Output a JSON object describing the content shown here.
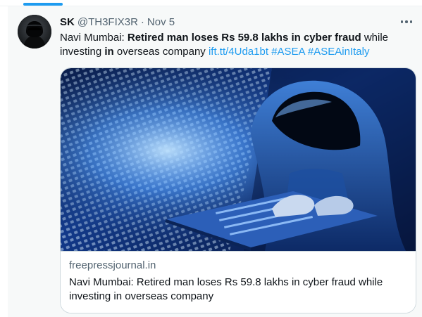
{
  "tweet": {
    "display_name": "SK",
    "handle": "@TH3FIX3R",
    "separator": "·",
    "timestamp": "Nov 5",
    "text": {
      "part1": "Navi Mumbai: ",
      "bold1": "Retired man loses Rs 59.8 lakhs in cyber fraud",
      "part2": " while investing ",
      "bold2": "in",
      "part3": " overseas company ",
      "link": "ift.tt/4Uda1bt",
      "space": " ",
      "hashtag1": "#ASEA",
      "hashtag2": "#ASEAinItaly"
    },
    "more_icon": "more-horizontal-icon"
  },
  "card": {
    "domain": "freepressjournal.in",
    "title": "Navi Mumbai: Retired man loses Rs 59.8 lakhs in cyber fraud while investing in overseas company",
    "image_description_icon": "hooded-hacker-laptop-image"
  },
  "colors": {
    "accent": "#1d9bf0",
    "text": "#0f1419",
    "secondary": "#536471",
    "background": "#f7f9f9",
    "border": "#cfd9de"
  }
}
